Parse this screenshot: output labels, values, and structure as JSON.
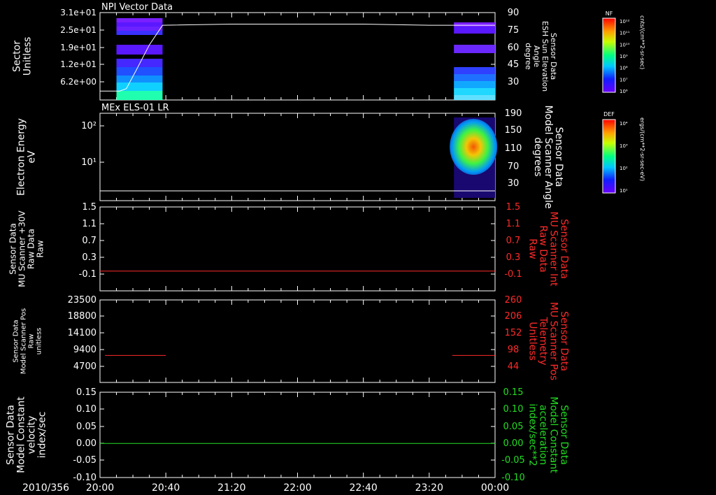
{
  "colors": {
    "white": "#ffffff",
    "red": "#ff2a2a",
    "green": "#22dd22",
    "bg": "#000000"
  },
  "time_axis": {
    "date_label": "2010/356",
    "ticks": [
      "20:00",
      "20:40",
      "21:20",
      "22:00",
      "22:40",
      "23:20",
      "00:00"
    ]
  },
  "chart_data": [
    {
      "type": "heatmap",
      "title": "NPI Vector Data",
      "ylabel": [
        "Sector",
        "Unitless"
      ],
      "y_ticks": [
        "3.1e+01",
        "2.5e+01",
        "1.9e+01",
        "1.2e+01",
        "6.2e+00"
      ],
      "right_ylabel": [
        "Sensor Data",
        "ESH Sun Elevation",
        "Angle",
        "degree"
      ],
      "right_ticks": [
        "90",
        "75",
        "60",
        "45",
        "30"
      ],
      "right_range": [
        18,
        90
      ],
      "overlay_series": {
        "name": "ESH Sun Elevation Angle",
        "x": [
          "20:00",
          "20:12",
          "20:16",
          "20:22",
          "20:30",
          "20:38",
          "21:20",
          "22:00",
          "22:40",
          "23:20",
          "00:00"
        ],
        "y": [
          22,
          22,
          24,
          40,
          62,
          79,
          80,
          80,
          80,
          79,
          79
        ]
      },
      "colorbar": {
        "label": "NF",
        "units": "cnts/(cm**2-sr-sec)",
        "ticks": [
          "10¹²",
          "10¹¹",
          "10¹⁰",
          "10⁹",
          "10⁸",
          "10⁷",
          "10⁶"
        ]
      }
    },
    {
      "type": "heatmap",
      "title": "MEx ELS-01 LR",
      "ylabel": [
        "Electron Energy",
        "eV"
      ],
      "y_ticks": [
        "10²",
        "10¹"
      ],
      "right_ylabel": [
        "Sensor Data",
        "Model Scanner Angle",
        "degrees"
      ],
      "right_ticks": [
        "190",
        "150",
        "110",
        "70",
        "30"
      ],
      "overlay_series": {
        "name": "Model Scanner Angle",
        "x": [
          "20:00",
          "00:00"
        ],
        "y": [
          10,
          10
        ]
      },
      "colorbar": {
        "label": "DEF",
        "units": "ergs/(cm**2-sr-sec-eV)",
        "ticks": [
          "10⁴",
          "10³",
          "10²",
          "10¹"
        ]
      }
    },
    {
      "type": "line",
      "ylabel": [
        "Sensor Data",
        "MU Scanner +30V",
        "Raw Data",
        "Raw"
      ],
      "y_ticks": [
        "1.5",
        "1.1",
        "0.7",
        "0.3",
        "-0.1"
      ],
      "right_ylabel": [
        "Sensor Data",
        "MU Scanner Int",
        "Raw Data",
        "Raw"
      ],
      "right_ticks": [
        "1.5",
        "1.1",
        "0.7",
        "0.3",
        "-0.1"
      ],
      "ylim": [
        -0.3,
        1.5
      ],
      "series": [
        {
          "x": [
            "20:00",
            "00:00"
          ],
          "y": [
            -0.03,
            -0.03
          ]
        }
      ]
    },
    {
      "type": "line",
      "ylabel": [
        "Sensor Data",
        "Model Scanner Pos",
        "Raw",
        "unitless"
      ],
      "y_ticks": [
        "23500",
        "18800",
        "14100",
        "9400",
        "4700"
      ],
      "right_ylabel": [
        "Sensor Data",
        "MU Scanner Pos",
        "Telemetry",
        "Unitless"
      ],
      "right_ticks": [
        "260",
        "206",
        "152",
        "98",
        "44"
      ],
      "ylim": [
        0,
        23500
      ],
      "series": [
        {
          "x": [
            "20:03",
            "20:40"
          ],
          "y": [
            7800,
            7800
          ]
        },
        {
          "x": [
            "23:34",
            "00:00"
          ],
          "y": [
            7800,
            7800
          ]
        }
      ]
    },
    {
      "type": "line",
      "ylabel": [
        "Sensor Data",
        "Model Constant",
        "velocity",
        "index/sec"
      ],
      "y_ticks": [
        "0.15",
        "0.10",
        "0.05",
        "0.00",
        "-0.05",
        "-0.10"
      ],
      "right_ylabel": [
        "Sensor Data",
        "Model Constant",
        "acceleration",
        "index/sec**2"
      ],
      "right_ticks": [
        "0.15",
        "0.10",
        "0.05",
        "0.00",
        "-0.05",
        "-0.10"
      ],
      "ylim": [
        -0.1,
        0.15
      ],
      "series": [
        {
          "x": [
            "20:00",
            "00:00"
          ],
          "y": [
            0,
            0
          ]
        }
      ]
    }
  ]
}
